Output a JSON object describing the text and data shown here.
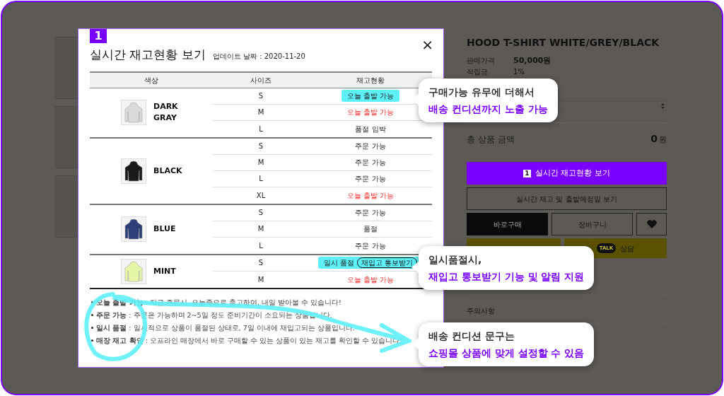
{
  "product": {
    "title": "HOOD T-SHIRT WHITE/GREY/BLACK",
    "info": [
      {
        "label": "판매가격",
        "value": "50,000원"
      },
      {
        "label": "적립금",
        "value": "1%"
      }
    ],
    "total_label": "총 상품 금액",
    "total_value": "0",
    "total_unit": "원",
    "primary_button": {
      "badge": "1",
      "label": "실시간 재고현황 보기"
    },
    "secondary_button": "실시간 재고 및 출발예정일 보기",
    "buy_button": "바로구매",
    "cart_button": "장바구니",
    "talk_badge": "TALK",
    "talk_button": "상담",
    "notice": "주의사항"
  },
  "modal": {
    "badge": "1",
    "title": "실시간 재고현황 보기",
    "updated": "업데이트 날짜 : 2020-11-20",
    "close": "×",
    "columns": [
      "색상",
      "사이즈",
      "재고현황"
    ],
    "colors": [
      {
        "name": "DARK GRAY",
        "color": "#d9d9d9",
        "rows": [
          {
            "size": "S",
            "status": "오늘 출발 가능",
            "kind": "normal",
            "highlighted": true
          },
          {
            "size": "M",
            "status": "오늘 출발 가능",
            "kind": "today",
            "highlighted": false
          },
          {
            "size": "L",
            "status": "품절 임박",
            "kind": "normal",
            "highlighted": false
          }
        ]
      },
      {
        "name": "BLACK",
        "color": "#1a1a1a",
        "rows": [
          {
            "size": "S",
            "status": "주문 가능",
            "kind": "normal",
            "highlighted": false
          },
          {
            "size": "M",
            "status": "주문 가능",
            "kind": "normal",
            "highlighted": false
          },
          {
            "size": "L",
            "status": "주문 가능",
            "kind": "normal",
            "highlighted": false
          },
          {
            "size": "XL",
            "status": "오늘 출발 가능",
            "kind": "today",
            "highlighted": false
          }
        ]
      },
      {
        "name": "BLUE",
        "color": "#2e3f7a",
        "rows": [
          {
            "size": "S",
            "status": "주문 가능",
            "kind": "normal",
            "highlighted": false
          },
          {
            "size": "M",
            "status": "품절",
            "kind": "normal",
            "highlighted": false
          },
          {
            "size": "L",
            "status": "주문 가능",
            "kind": "normal",
            "highlighted": false
          }
        ]
      },
      {
        "name": "MINT",
        "color": "#e4f5a8",
        "rows": [
          {
            "size": "S",
            "status": "일시 품절",
            "kind": "normal",
            "highlighted": true,
            "button": "재입고 통보받기"
          },
          {
            "size": "M",
            "status": "오늘 출발 가능",
            "kind": "today",
            "highlighted": false
          }
        ]
      }
    ],
    "legend": [
      "**오늘 출발 가능** : 지금 주문시, 오늘중으로 출고하여, 내일 받아볼 수 있습니다!",
      "**주문 가능** : 주문은 가능하며 2~5일 정도 준비기간이 소요되는 상품입니다.",
      "**일시 품절** : 일시적으로 상품이 품절된 상태로, 7일 이내에 재입고되는 상품입니다.",
      "**매장 재고 확인** : 오프라인 매장에서 바로 구매할 수 있는 상품이 있는 재고를 확인할 수 있습니다!"
    ]
  },
  "callouts": [
    {
      "line1": "구매가능 유무에 더해서",
      "line2": "배송 컨디션까지 노출 가능"
    },
    {
      "line1": "일시품절시,",
      "line2": "재입고 통보받기 기능 및 알림 지원"
    },
    {
      "line1": "배송 컨디션 문구는",
      "line2": "쇼핑몰 상품에 맞게 설정할 수 있음"
    }
  ]
}
